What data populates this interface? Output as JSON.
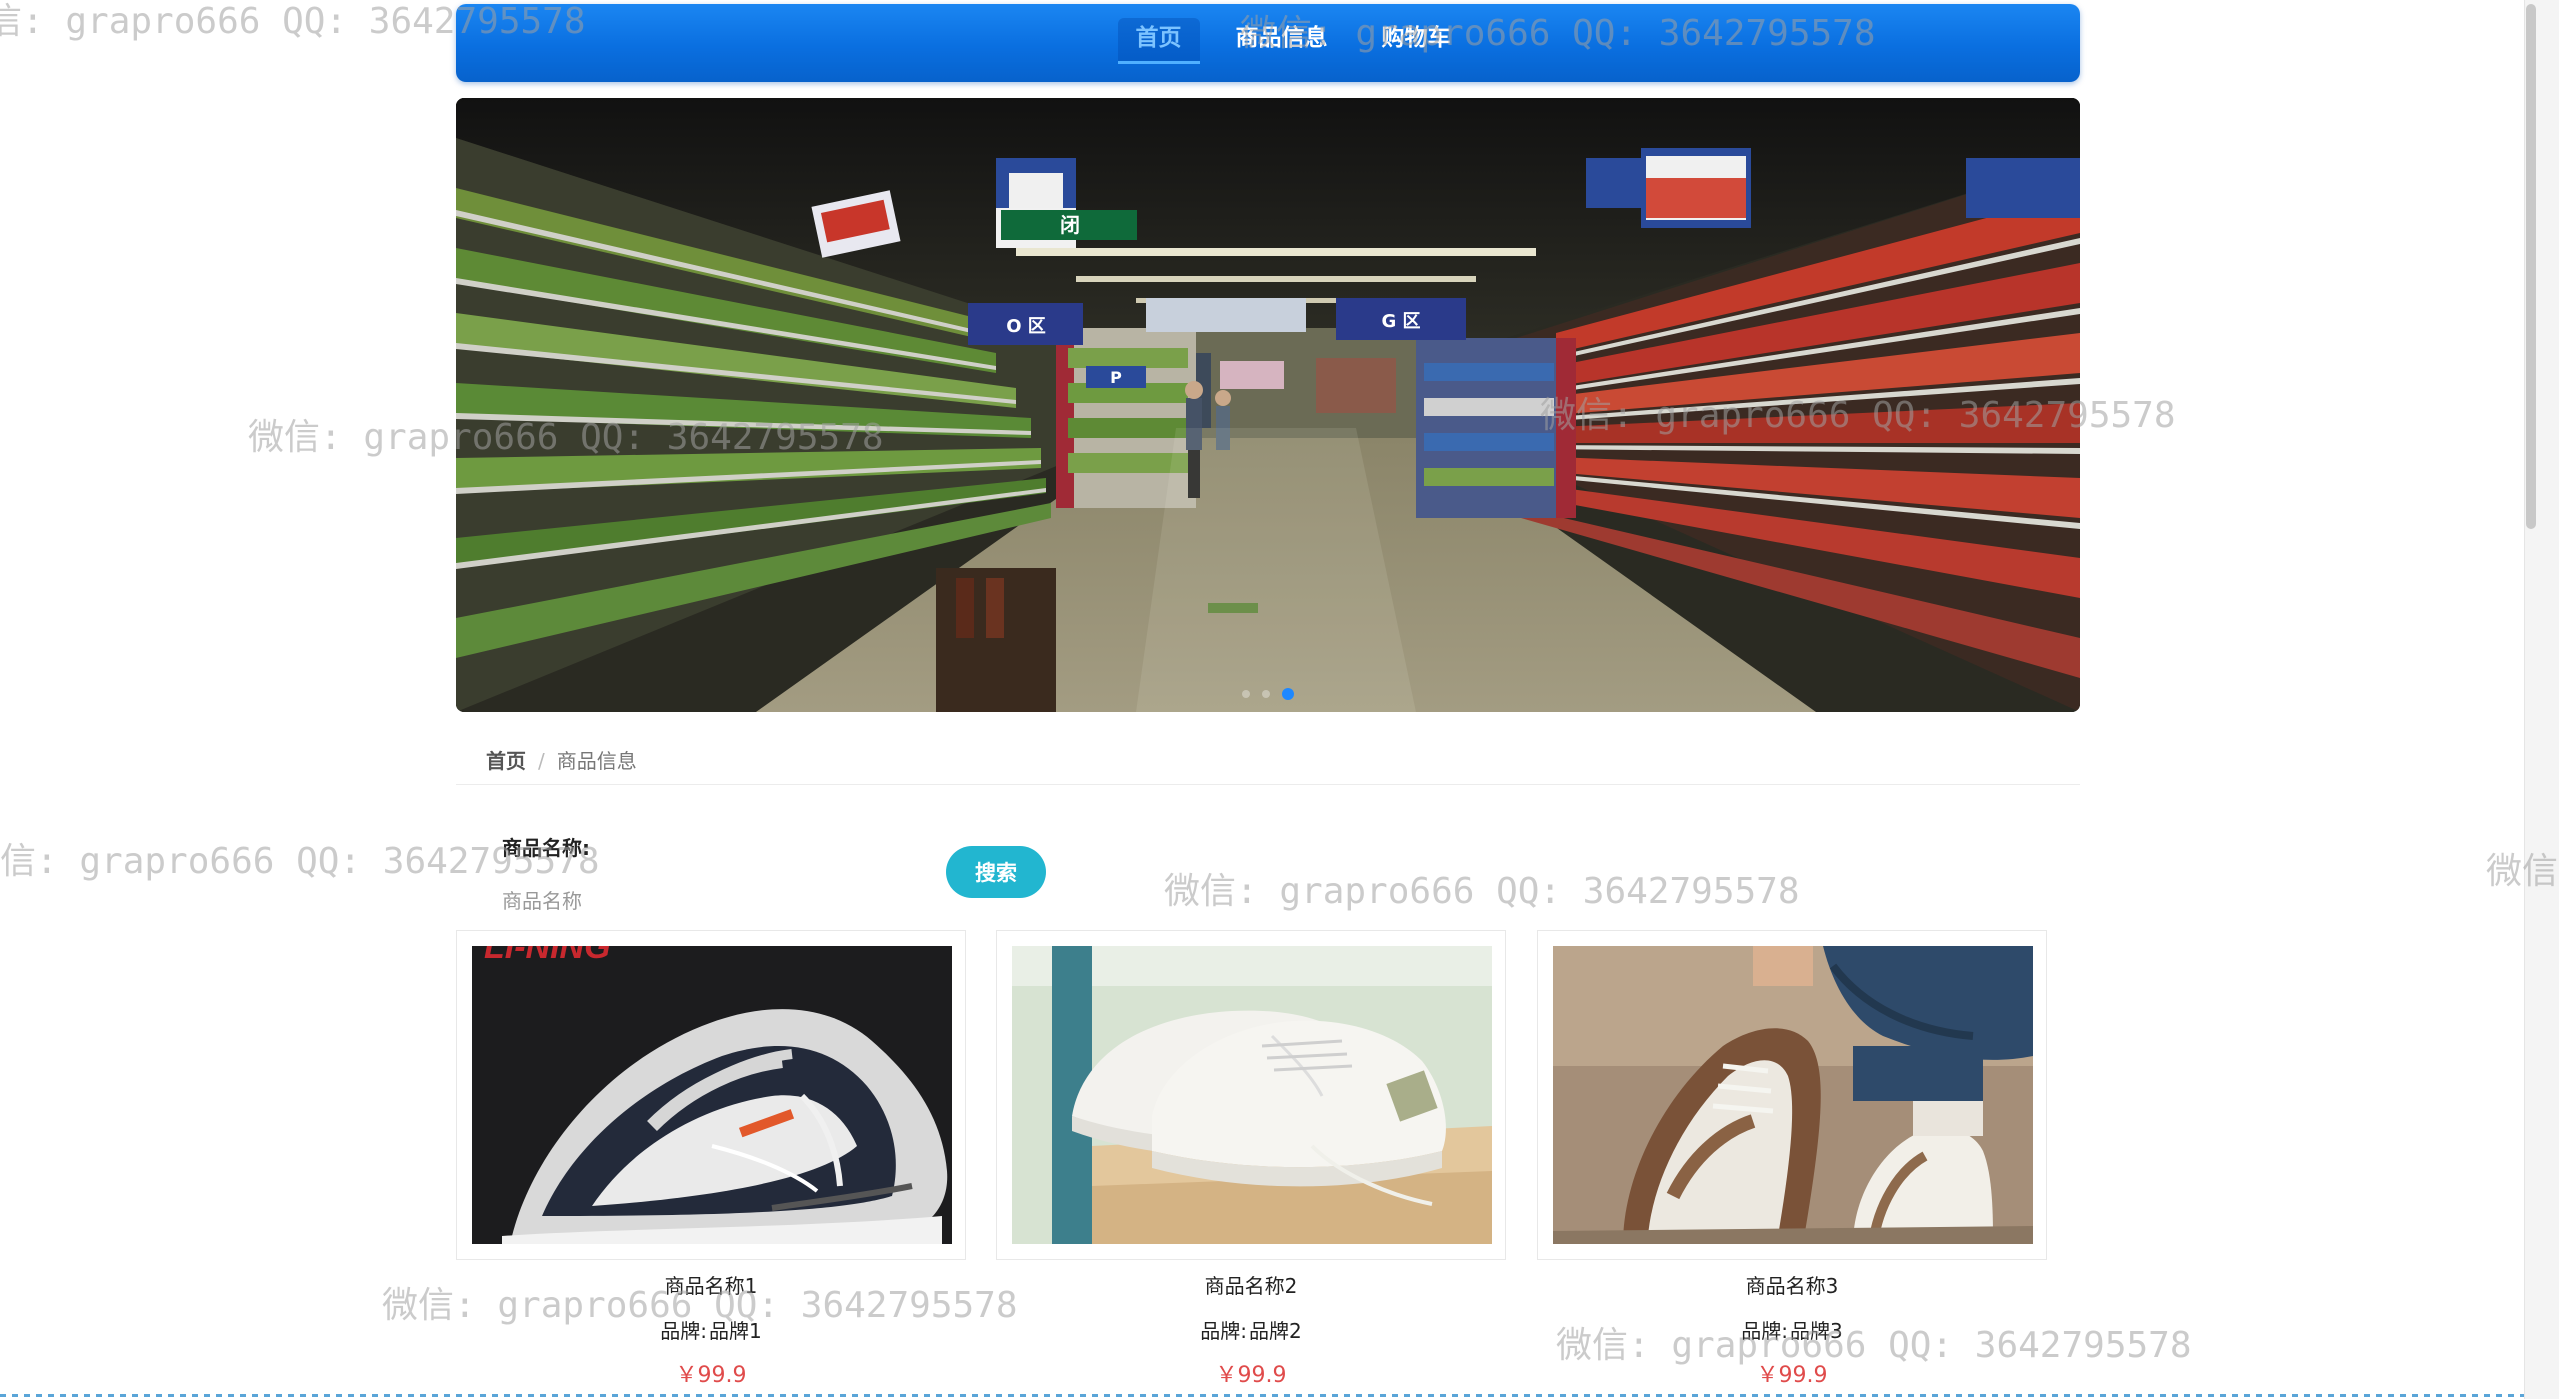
{
  "nav": {
    "items": [
      {
        "label": "首页",
        "active": true
      },
      {
        "label": "商品信息",
        "active": false
      },
      {
        "label": "购物车",
        "active": false
      }
    ],
    "colors": {
      "bar": "#0a6fe0",
      "active_text": "#7cc3ff"
    }
  },
  "carousel": {
    "image": "supermarket-aisle-photo",
    "slide_count": 3,
    "active_slide": 3,
    "signs": {
      "exit": "闭",
      "zone_o": "O 区",
      "zone_g": "G 区",
      "zone_p": "P"
    }
  },
  "breadcrumb": {
    "home": "首页",
    "separator": "/",
    "current": "商品信息"
  },
  "search": {
    "label": "商品名称:",
    "placeholder": "商品名称",
    "value": "",
    "button_label": "搜索",
    "button_color": "#22b6d0"
  },
  "products": [
    {
      "name": "商品名称1",
      "brand_label": "品牌:",
      "brand": "品牌1",
      "price": "￥99.9",
      "image": "black-grey-sneaker-photo",
      "image_text": "LI-NING"
    },
    {
      "name": "商品名称2",
      "brand_label": "品牌:",
      "brand": "品牌2",
      "price": "￥99.9",
      "image": "white-sneaker-photo"
    },
    {
      "name": "商品名称3",
      "brand_label": "品牌:",
      "brand": "品牌3",
      "price": "￥99.9",
      "image": "brown-white-sneaker-photo"
    }
  ],
  "price_color": "#e04b4b",
  "watermarks": [
    "信: grapro666 QQ: 3642795578",
    "微信: grapro666 QQ: 3642795578",
    "微信: grapro666 QQ: 3642795578",
    "微信: grapro666 QQ: 3642795578",
    "信: grapro666 QQ: 3642795578",
    "微信: grapro666 QQ: 3642795578",
    "微信",
    "微信: grapro666 QQ: 3642795578",
    "微信: grapro666 QQ: 3642795578"
  ]
}
